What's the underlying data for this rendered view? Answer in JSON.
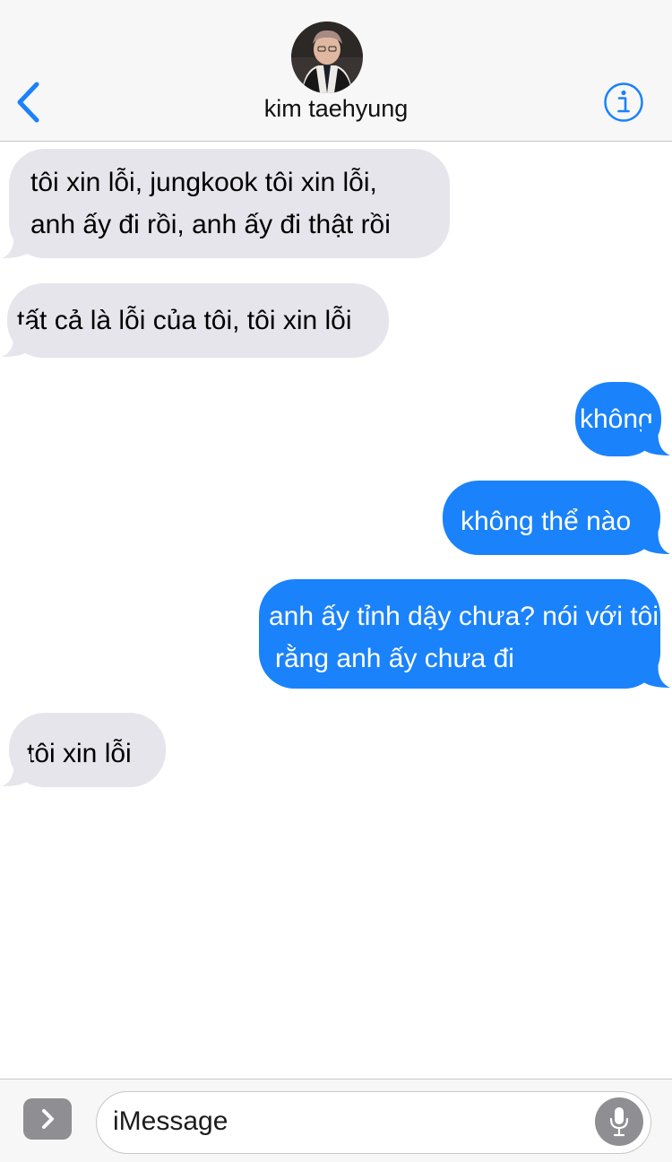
{
  "header": {
    "contact_name": "kim taehyung"
  },
  "messages": [
    {
      "direction": "incoming",
      "lines": [
        "tôi xin lỗi, jungkook tôi xin lỗi,",
        "anh ấy đi rồi, anh ấy đi thật rồi"
      ]
    },
    {
      "direction": "incoming",
      "lines": [
        "tất cả là lỗi của tôi, tôi xin lỗi"
      ]
    },
    {
      "direction": "outgoing",
      "lines": [
        "không"
      ]
    },
    {
      "direction": "outgoing",
      "lines": [
        "không thể nào"
      ]
    },
    {
      "direction": "outgoing",
      "lines": [
        "anh ấy tỉnh dậy chưa? nói với tôi",
        "rằng anh ấy chưa đi"
      ]
    },
    {
      "direction": "incoming",
      "lines": [
        "tôi xin lỗi"
      ]
    }
  ],
  "composer": {
    "placeholder": "iMessage"
  },
  "icons": {
    "back": "chevron-left-icon",
    "info": "info-icon",
    "apps": "chevron-right-icon",
    "mic": "microphone-icon"
  },
  "colors": {
    "accent": "#1a82fb",
    "incoming_bubble": "#e6e5eb",
    "header_bg": "#f7f7f7"
  }
}
